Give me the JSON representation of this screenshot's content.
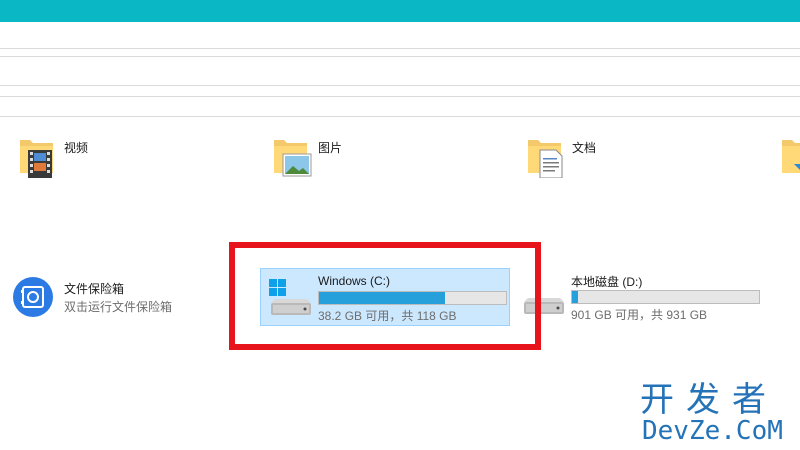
{
  "folders": [
    {
      "label": "视频",
      "icon": "video-folder-icon"
    },
    {
      "label": "图片",
      "icon": "pictures-folder-icon"
    },
    {
      "label": "文档",
      "icon": "documents-folder-icon"
    },
    {
      "label": "",
      "icon": "downloads-folder-icon"
    }
  ],
  "vault": {
    "title": "文件保险箱",
    "subtitle": "双击运行文件保险箱",
    "icon": "safe-icon"
  },
  "drives": [
    {
      "name": "Windows (C:)",
      "info": "38.2 GB 可用，共 118 GB",
      "used_fraction": 0.676,
      "icon": "windows-drive-icon",
      "selected": true
    },
    {
      "name": "本地磁盘 (D:)",
      "info": "901 GB 可用，共 931 GB",
      "used_fraction": 0.032,
      "icon": "local-drive-icon",
      "selected": false
    }
  ],
  "watermark": {
    "line1": "开发者",
    "line2": "DevZe.CoM"
  },
  "colors": {
    "titlebar": "#09b8c4",
    "highlight": "#e8141c",
    "bar_fill": "#26a0da",
    "selection_bg": "#cce8ff",
    "watermark": "#2472b8"
  }
}
